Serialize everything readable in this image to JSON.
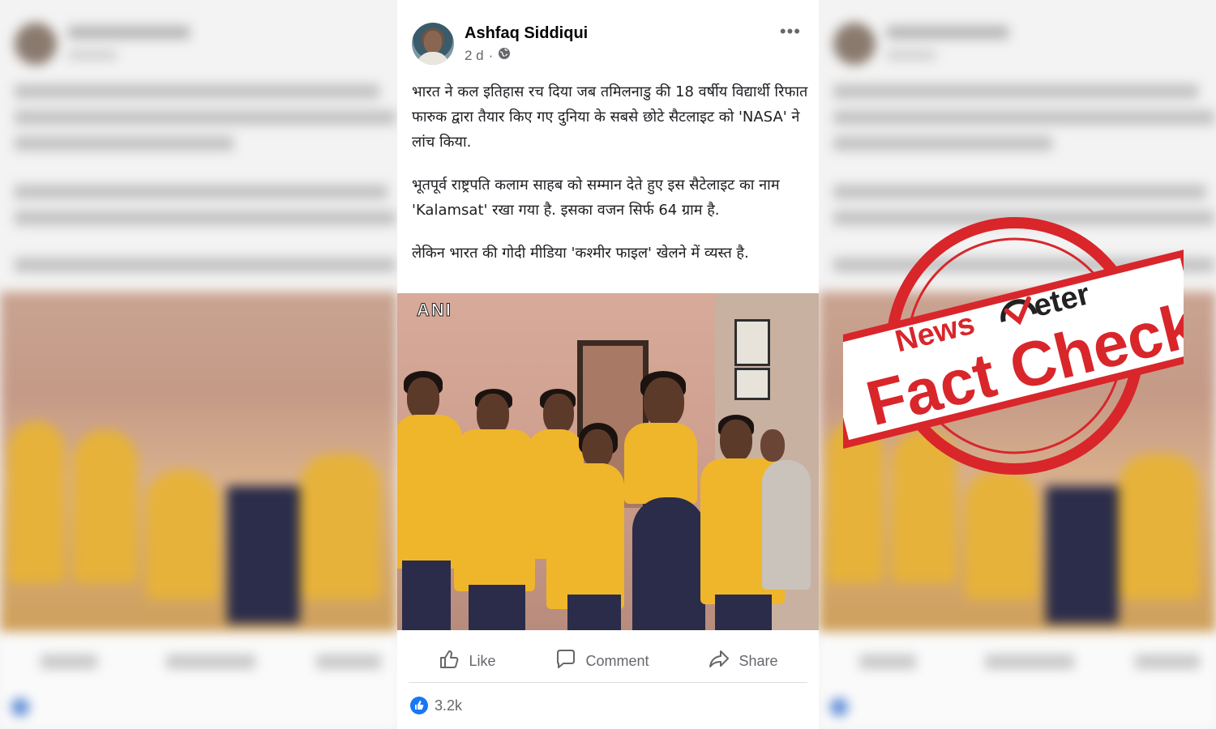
{
  "post": {
    "author": "Ashfaq Siddiqui",
    "time": "2 d",
    "privacy_icon": "globe-icon",
    "more_icon": "more-options-icon",
    "paragraphs": [
      "भारत ने कल इतिहास रच दिया जब तमिलनाडु की 18 वर्षीय विद्यार्थी रिफात फारुक द्वारा तैयार किए गए  दुनिया के सबसे छोटे सैटलाइट को 'NASA' ने लांच किया.",
      "भूतपूर्व राष्ट्रपति कलाम साहब को सम्मान देते हुए इस सैटेलाइट का नाम 'Kalamsat' रखा गया है. इसका वजन सिर्फ 64 ग्राम है.",
      "लेकिन भारत की गोदी मीडिया 'कश्मीर फाइल' खेलने में व्यस्त है."
    ],
    "image_watermark": "ANI",
    "actions": {
      "like": "Like",
      "comment": "Comment",
      "share": "Share"
    },
    "reaction_count": "3.2k"
  },
  "stamp": {
    "brand_top": "News",
    "brand_right": "eter",
    "label": "Fact Check",
    "color": "#d8262b"
  },
  "colors": {
    "accent": "#1877f2",
    "text": "#1c1e21",
    "muted": "#65676b"
  }
}
